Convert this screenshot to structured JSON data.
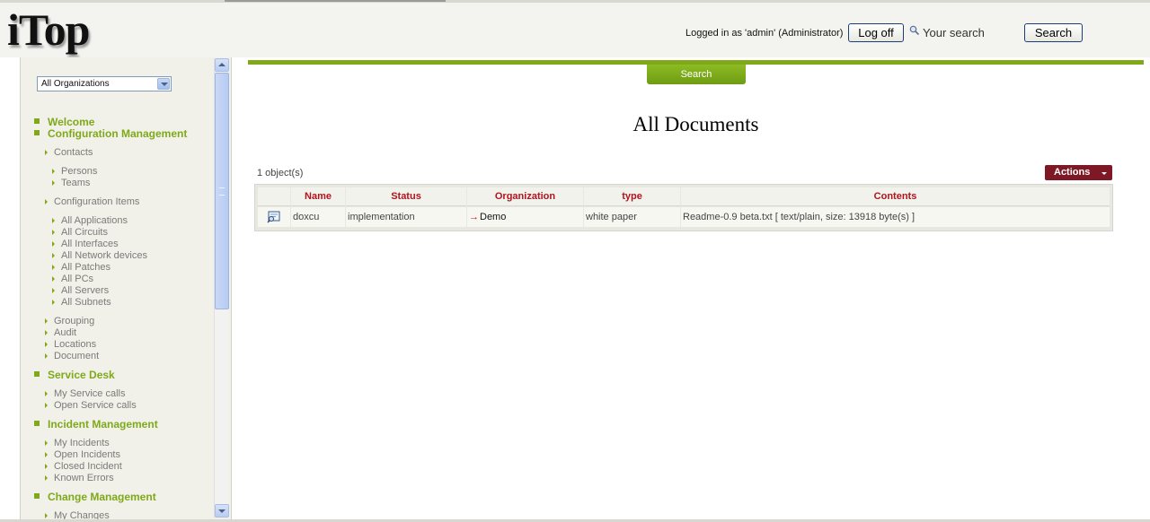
{
  "header": {
    "logo": "iTop",
    "logged_in": "Logged in as 'admin' (Administrator)",
    "logoff_label": "Log off",
    "search_placeholder": "Your search",
    "search_button": "Search"
  },
  "sidebar": {
    "org_select": "All Organizations",
    "sections": [
      {
        "label": "Welcome"
      },
      {
        "label": "Configuration Management"
      },
      {
        "label": "Service Desk"
      },
      {
        "label": "Incident Management"
      },
      {
        "label": "Change Management"
      }
    ],
    "items": {
      "contacts": "Contacts",
      "persons": "Persons",
      "teams": "Teams",
      "configuration_items": "Configuration Items",
      "all_applications": "All Applications",
      "all_circuits": "All Circuits",
      "all_interfaces": "All Interfaces",
      "all_network_devices": "All Network devices",
      "all_patches": "All Patches",
      "all_pcs": "All PCs",
      "all_servers": "All Servers",
      "all_subnets": "All Subnets",
      "grouping": "Grouping",
      "audit": "Audit",
      "locations": "Locations",
      "document": "Document",
      "my_service_calls": "My Service calls",
      "open_service_calls": "Open Service calls",
      "my_incidents": "My Incidents",
      "open_incidents": "Open Incidents",
      "closed_incident": "Closed Incident",
      "known_errors": "Known Errors",
      "my_changes": "My Changes"
    }
  },
  "main": {
    "search_tab": "Search",
    "title": "All Documents",
    "object_count": "1 object(s)",
    "actions_label": "Actions",
    "table": {
      "columns": [
        "Name",
        "Status",
        "Organization",
        "type",
        "Contents"
      ],
      "rows": [
        {
          "name": "doxcu",
          "status": "implementation",
          "organization": "Demo",
          "type": "white paper",
          "contents": "Readme-0.9 beta.txt [ text/plain, size: 13918 byte(s) ]"
        }
      ]
    }
  },
  "colors": {
    "accent_green": "#7fa919",
    "header_red": "#b0141e",
    "actions_bg": "#7d1824"
  }
}
